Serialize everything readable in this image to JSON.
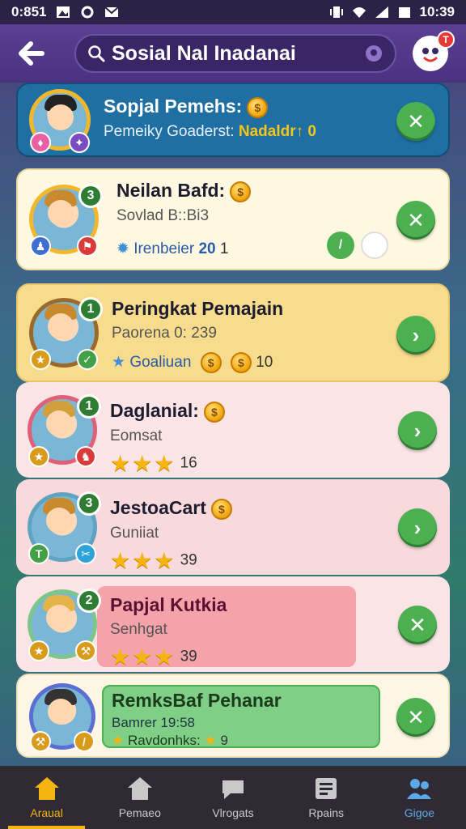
{
  "status_bar": {
    "time_left": "0:851",
    "time_right": "10:39"
  },
  "search": {
    "query": "Sosial Nal Inadanai"
  },
  "notification_badge": "T",
  "cards": [
    {
      "name": "Sopjal Pemehs:",
      "sub": "Pemeiky Goaderst:",
      "meta": "Nadaldr↑ 0",
      "rank": "",
      "action": "close",
      "bg": "#1f6fa3"
    },
    {
      "name": "Neilan Bafd:",
      "sub": "Sovlad B::Bi3",
      "meta": "Irenbeier",
      "meta_num": "20",
      "meta_tail": "1",
      "rank": "3",
      "action": "close",
      "bg": "#fff8e1"
    },
    {
      "name": "Peringkat Pemajain",
      "sub": "Paorena 0: 239",
      "meta": "Goaliuan",
      "meta_num": "10",
      "rank": "1",
      "action": "chevron",
      "bg": "#f6dc8c"
    },
    {
      "name": "Daglanial:",
      "sub": "Eomsat",
      "stars": "★★★",
      "meta_num": "16",
      "rank": "1",
      "action": "chevron",
      "bg": "#fbe4e6"
    },
    {
      "name": "JestoaCart",
      "sub": "Guniiat",
      "stars": "★★★",
      "meta_num": "39",
      "rank": "3",
      "action": "chevron",
      "bg": "#f8d9dc"
    },
    {
      "name": "Papjal Kutkia",
      "sub": "Senhgat",
      "stars": "★★★",
      "meta_num": "39",
      "rank": "2",
      "action": "close",
      "bg": "#f7cfd3"
    },
    {
      "name": "RemksBaf Pehanar",
      "sub": "Bamrer 19:58",
      "meta": "Ravdonhks:",
      "meta_num": "9",
      "rank": "",
      "action": "close",
      "bg": "#fdf6e5"
    }
  ],
  "bottom_nav": [
    {
      "label": "Araual",
      "icon": "home-icon",
      "active": true
    },
    {
      "label": "Pemaeo",
      "icon": "home-outline-icon",
      "active": false
    },
    {
      "label": "Vlrogats",
      "icon": "chat-icon",
      "active": false
    },
    {
      "label": "Rpains",
      "icon": "list-icon",
      "active": false
    },
    {
      "label": "Gigoe",
      "icon": "group-icon",
      "active": false
    }
  ],
  "colors": {
    "accent": "#f5b40f",
    "action_green": "#4caf50",
    "header": "#4a3280"
  }
}
